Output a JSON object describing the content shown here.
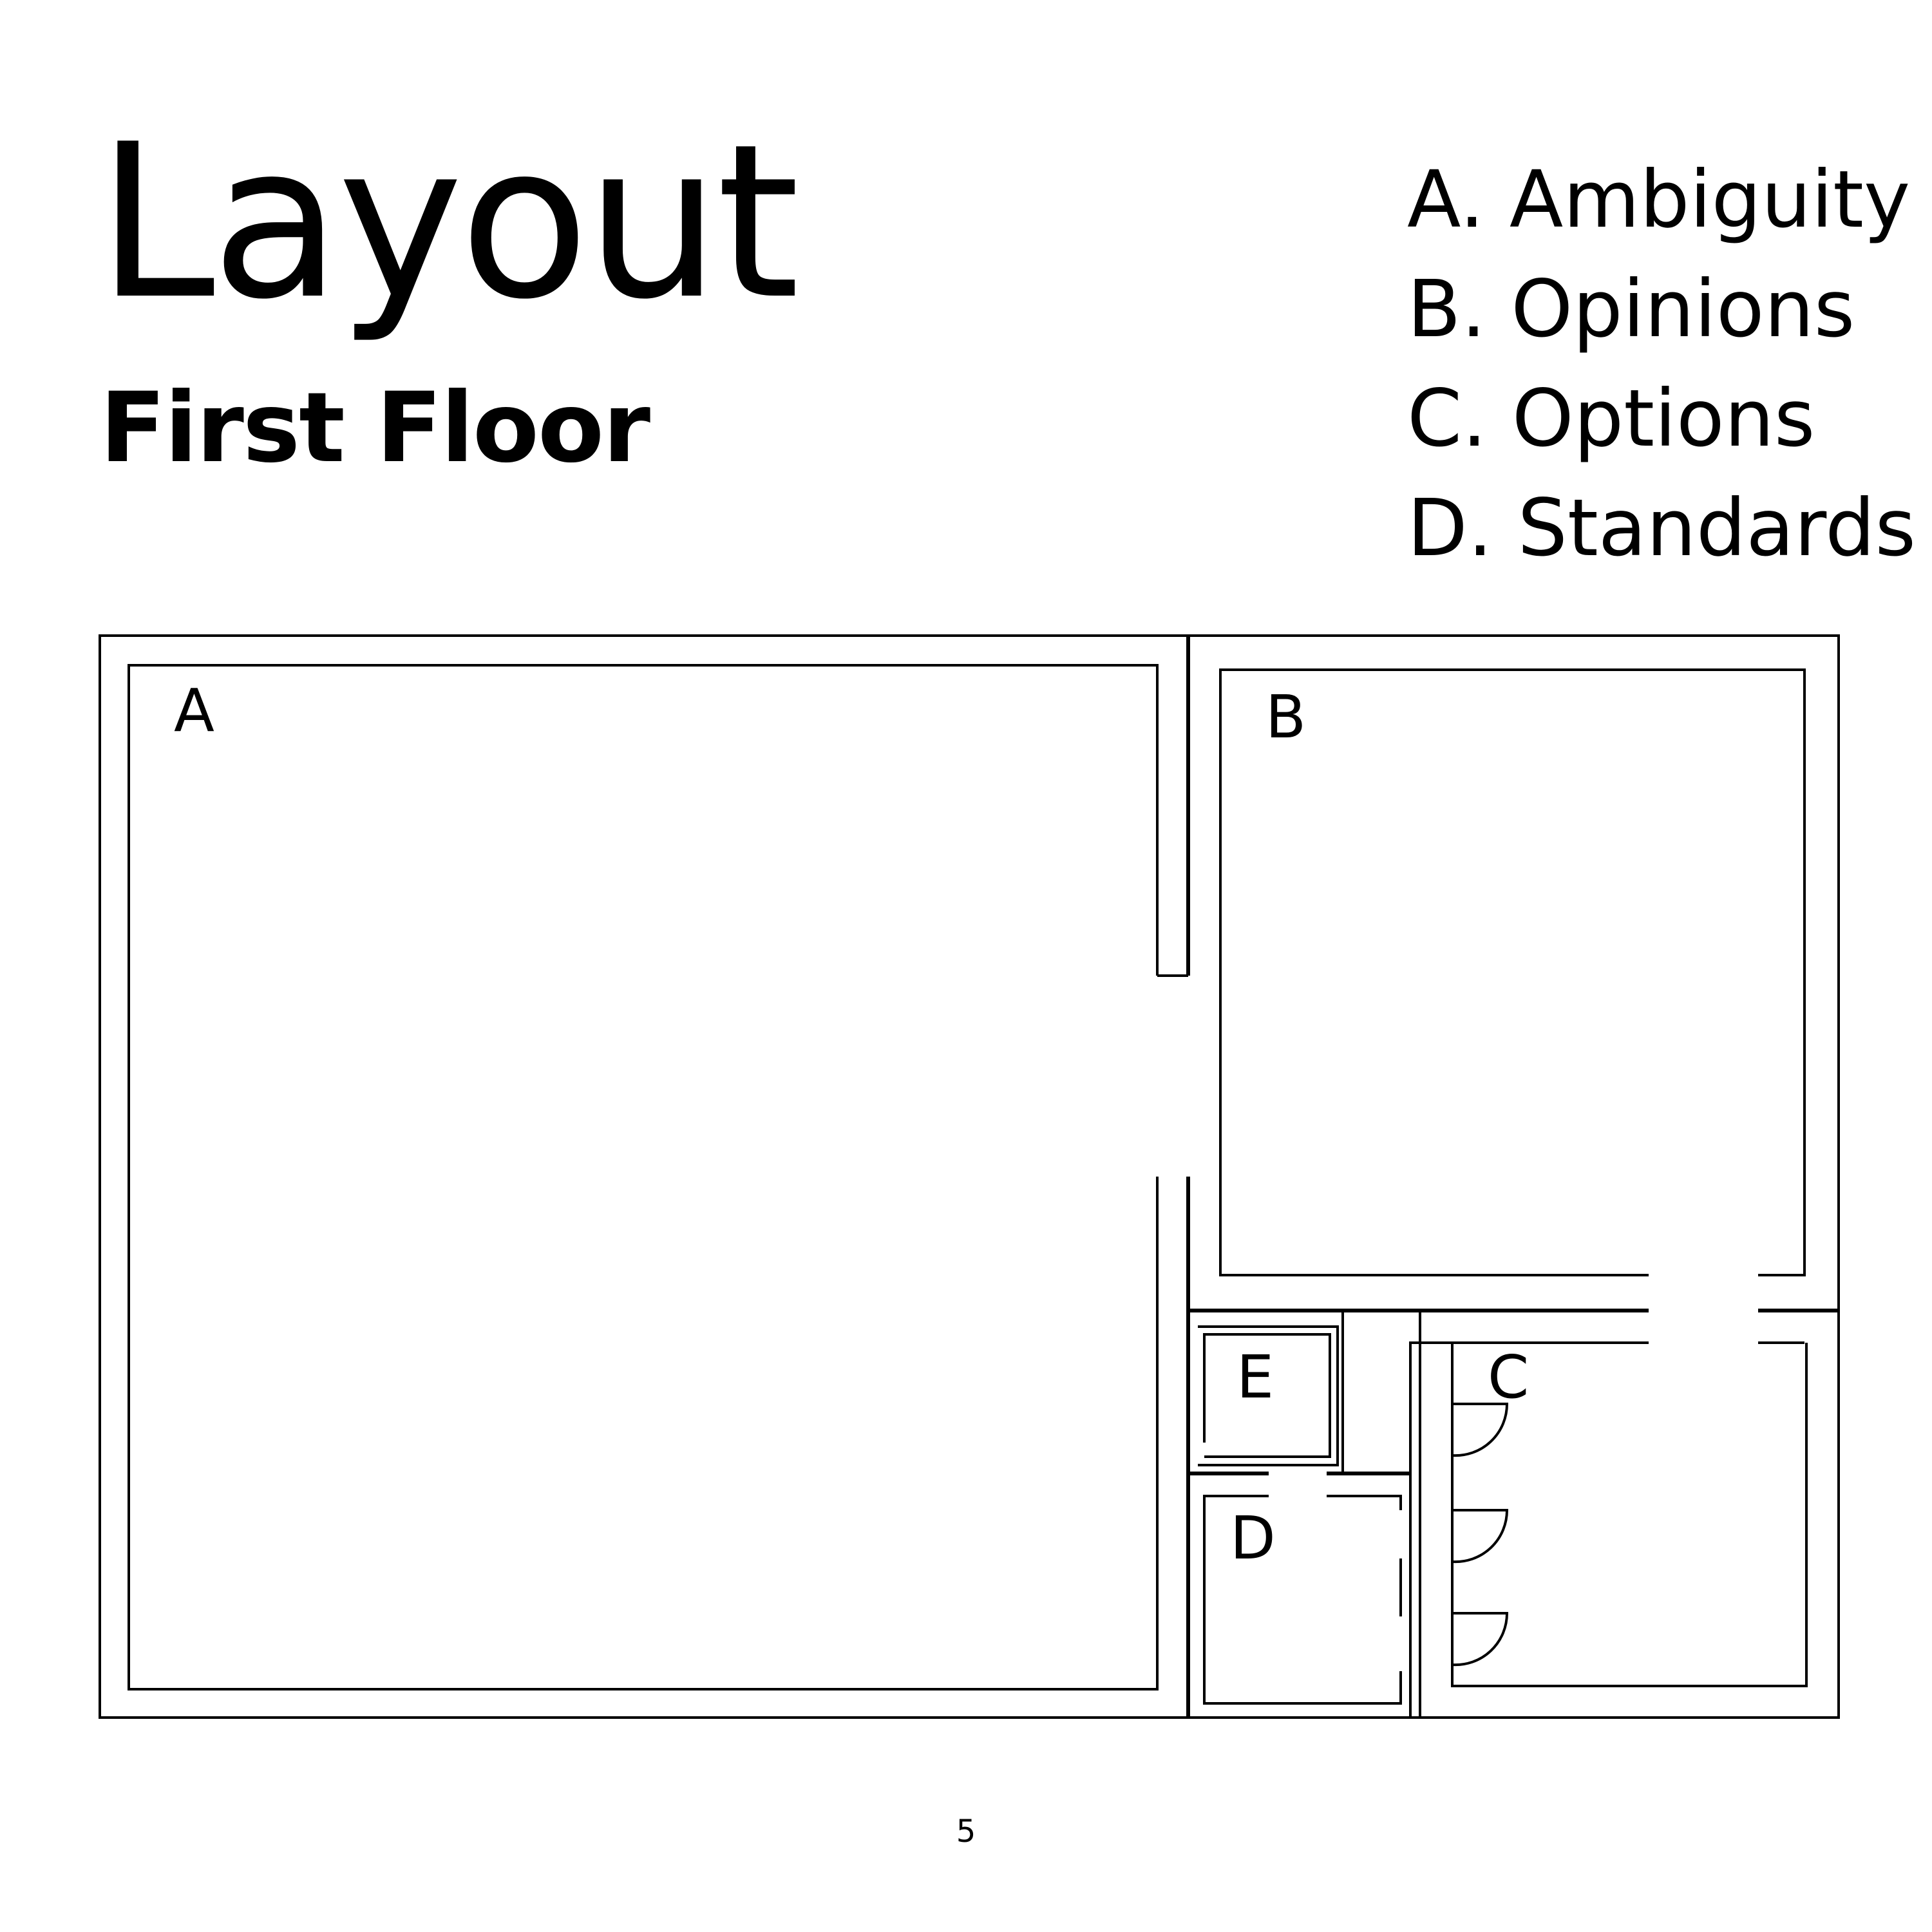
{
  "title": "Layout",
  "subtitle": "First Floor",
  "legend": [
    "A. Ambiguity",
    "B. Opinions",
    "C. Options",
    "D. Standards"
  ],
  "rooms": {
    "a": "A",
    "b": "B",
    "c": "C",
    "d": "D",
    "e": "E"
  },
  "page_number": "5"
}
